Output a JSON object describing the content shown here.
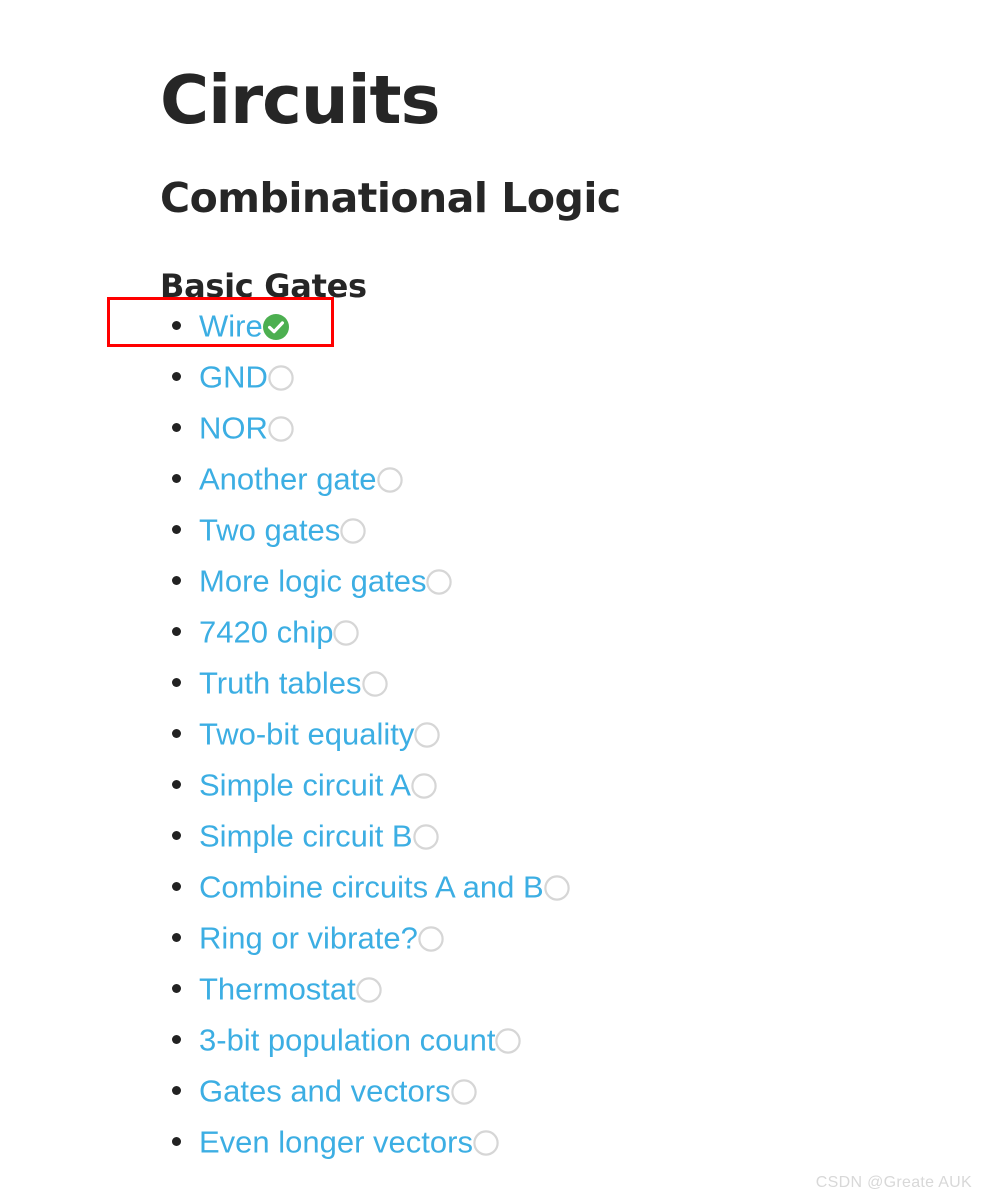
{
  "page": {
    "title": "Circuits",
    "subtitle": "Combinational Logic",
    "section": "Basic Gates",
    "background_color": "#ffffff",
    "heading_color": "#262626",
    "link_color": "#3caee3",
    "bullet_color": "#222222",
    "complete_color": "#4caf50",
    "incomplete_color": "#d6d6d6"
  },
  "annotation": {
    "highlight_color": "#ff0000",
    "highlight_target": "Wire"
  },
  "list": {
    "items": [
      {
        "label": "Wire",
        "status": "complete",
        "icon": "check-circle-filled-icon"
      },
      {
        "label": "GND",
        "status": "incomplete",
        "icon": "circle-outline-icon"
      },
      {
        "label": "NOR",
        "status": "incomplete",
        "icon": "circle-outline-icon"
      },
      {
        "label": "Another gate",
        "status": "incomplete",
        "icon": "circle-outline-icon"
      },
      {
        "label": "Two gates",
        "status": "incomplete",
        "icon": "circle-outline-icon"
      },
      {
        "label": "More logic gates",
        "status": "incomplete",
        "icon": "circle-outline-icon"
      },
      {
        "label": "7420 chip",
        "status": "incomplete",
        "icon": "circle-outline-icon"
      },
      {
        "label": "Truth tables",
        "status": "incomplete",
        "icon": "circle-outline-icon"
      },
      {
        "label": "Two-bit equality",
        "status": "incomplete",
        "icon": "circle-outline-icon"
      },
      {
        "label": "Simple circuit A",
        "status": "incomplete",
        "icon": "circle-outline-icon"
      },
      {
        "label": "Simple circuit B",
        "status": "incomplete",
        "icon": "circle-outline-icon"
      },
      {
        "label": "Combine circuits A and B",
        "status": "incomplete",
        "icon": "circle-outline-icon"
      },
      {
        "label": "Ring or vibrate?",
        "status": "incomplete",
        "icon": "circle-outline-icon"
      },
      {
        "label": "Thermostat",
        "status": "incomplete",
        "icon": "circle-outline-icon"
      },
      {
        "label": "3-bit population count",
        "status": "incomplete",
        "icon": "circle-outline-icon"
      },
      {
        "label": "Gates and vectors",
        "status": "incomplete",
        "icon": "circle-outline-icon"
      },
      {
        "label": "Even longer vectors",
        "status": "incomplete",
        "icon": "circle-outline-icon"
      }
    ]
  },
  "watermark": {
    "text": "CSDN @Greate AUK"
  }
}
